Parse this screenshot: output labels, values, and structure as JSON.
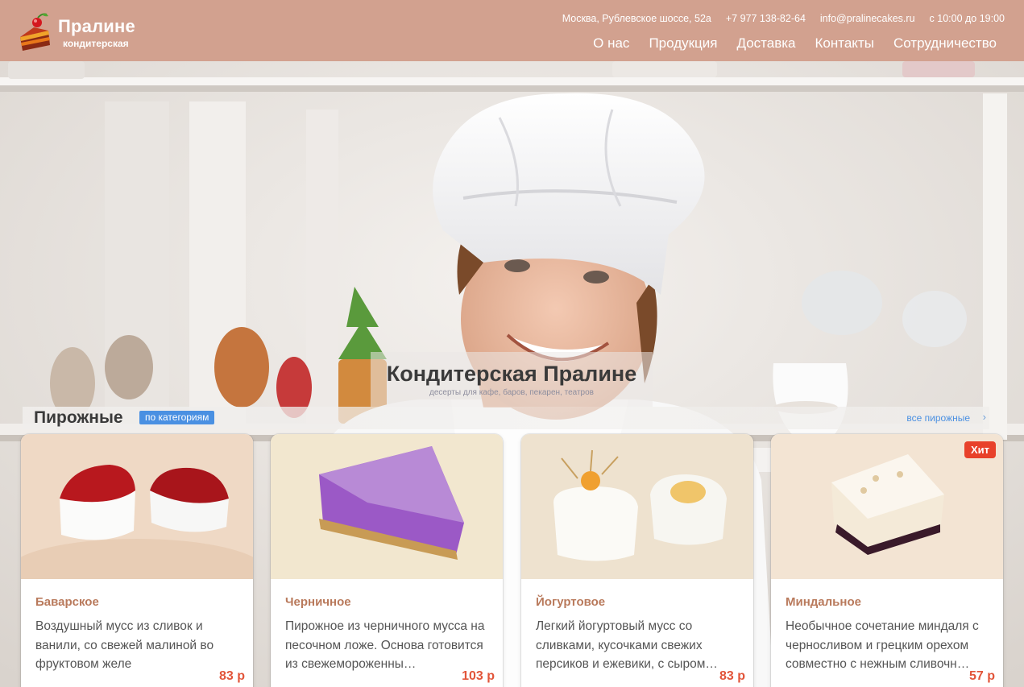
{
  "brand": {
    "name": "Пралине",
    "subtitle": "кондитерская"
  },
  "contacts": {
    "address": "Москва, Рублевское шоссе, 52а",
    "phone": "+7 977 138-82-64",
    "email": "info@pralinecakes.ru",
    "hours": "с 10:00 до 19:00"
  },
  "nav": [
    "О нас",
    "Продукция",
    "Доставка",
    "Контакты",
    "Сотрудничество"
  ],
  "hero": {
    "title": "Кондитерская Пралине",
    "subtitle": "десерты для кафе, баров, пекарен, театров"
  },
  "section": {
    "title": "Пирожные",
    "category_button": "по категориям",
    "all_link": "все пирожные",
    "all_arrow": "›"
  },
  "products": [
    {
      "name": "Баварское",
      "desc": "Воздушный мусс из сливок и ванили, со свежей малиной во фруктовом желе",
      "price": "83 р"
    },
    {
      "name": "Черничное",
      "desc": "Пирожное из черничного мусса на песочном ложе. Основа готовится из свежемороженны…",
      "price": "103 р"
    },
    {
      "name": "Йогуртовое",
      "desc": "Легкий йогуртовый мусс со сливками, кусочками свежих персиков и ежевики, с сыром…",
      "price": "83 р"
    },
    {
      "name": "Миндальное",
      "desc": "Необычное сочетание миндаля с черносливом и грецким орехом совместно с нежным сливочн…",
      "price": "57 р",
      "badge": "Хит"
    }
  ],
  "colors": {
    "header_bg": "#d2a18f",
    "accent_blue": "#4a90e2",
    "price_red": "#e2553a",
    "name_brown": "#b97a5c",
    "badge_red": "#e8412a"
  }
}
